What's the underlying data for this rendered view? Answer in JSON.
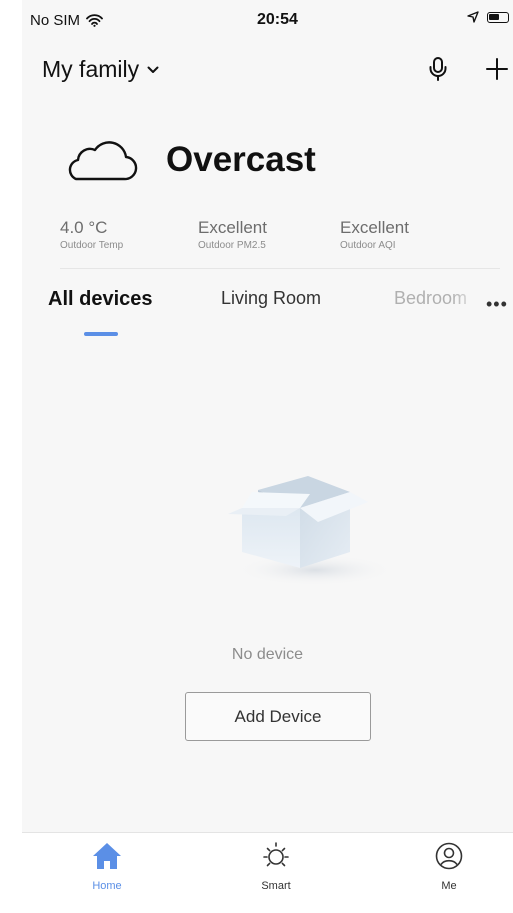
{
  "status_bar": {
    "carrier": "No SIM",
    "time": "20:54"
  },
  "header": {
    "home_name": "My family"
  },
  "weather": {
    "condition": "Overcast",
    "metrics": [
      {
        "value": "4.0 °C",
        "label": "Outdoor Temp"
      },
      {
        "value": "Excellent",
        "label": "Outdoor PM2.5"
      },
      {
        "value": "Excellent",
        "label": "Outdoor AQI"
      }
    ]
  },
  "tabs": [
    {
      "label": "All devices",
      "active": true
    },
    {
      "label": "Living Room",
      "active": false
    },
    {
      "label": "Bedroom",
      "active": false
    }
  ],
  "empty_state": {
    "message": "No device",
    "button_label": "Add Device"
  },
  "tab_bar": [
    {
      "label": "Home",
      "icon": "home-icon",
      "active": true
    },
    {
      "label": "Smart",
      "icon": "sun-icon",
      "active": false
    },
    {
      "label": "Me",
      "icon": "user-icon",
      "active": false
    }
  ],
  "colors": {
    "accent": "#5b8fe6",
    "background": "#f7f7f7",
    "text": "#111111",
    "muted": "#8c8c8c"
  }
}
